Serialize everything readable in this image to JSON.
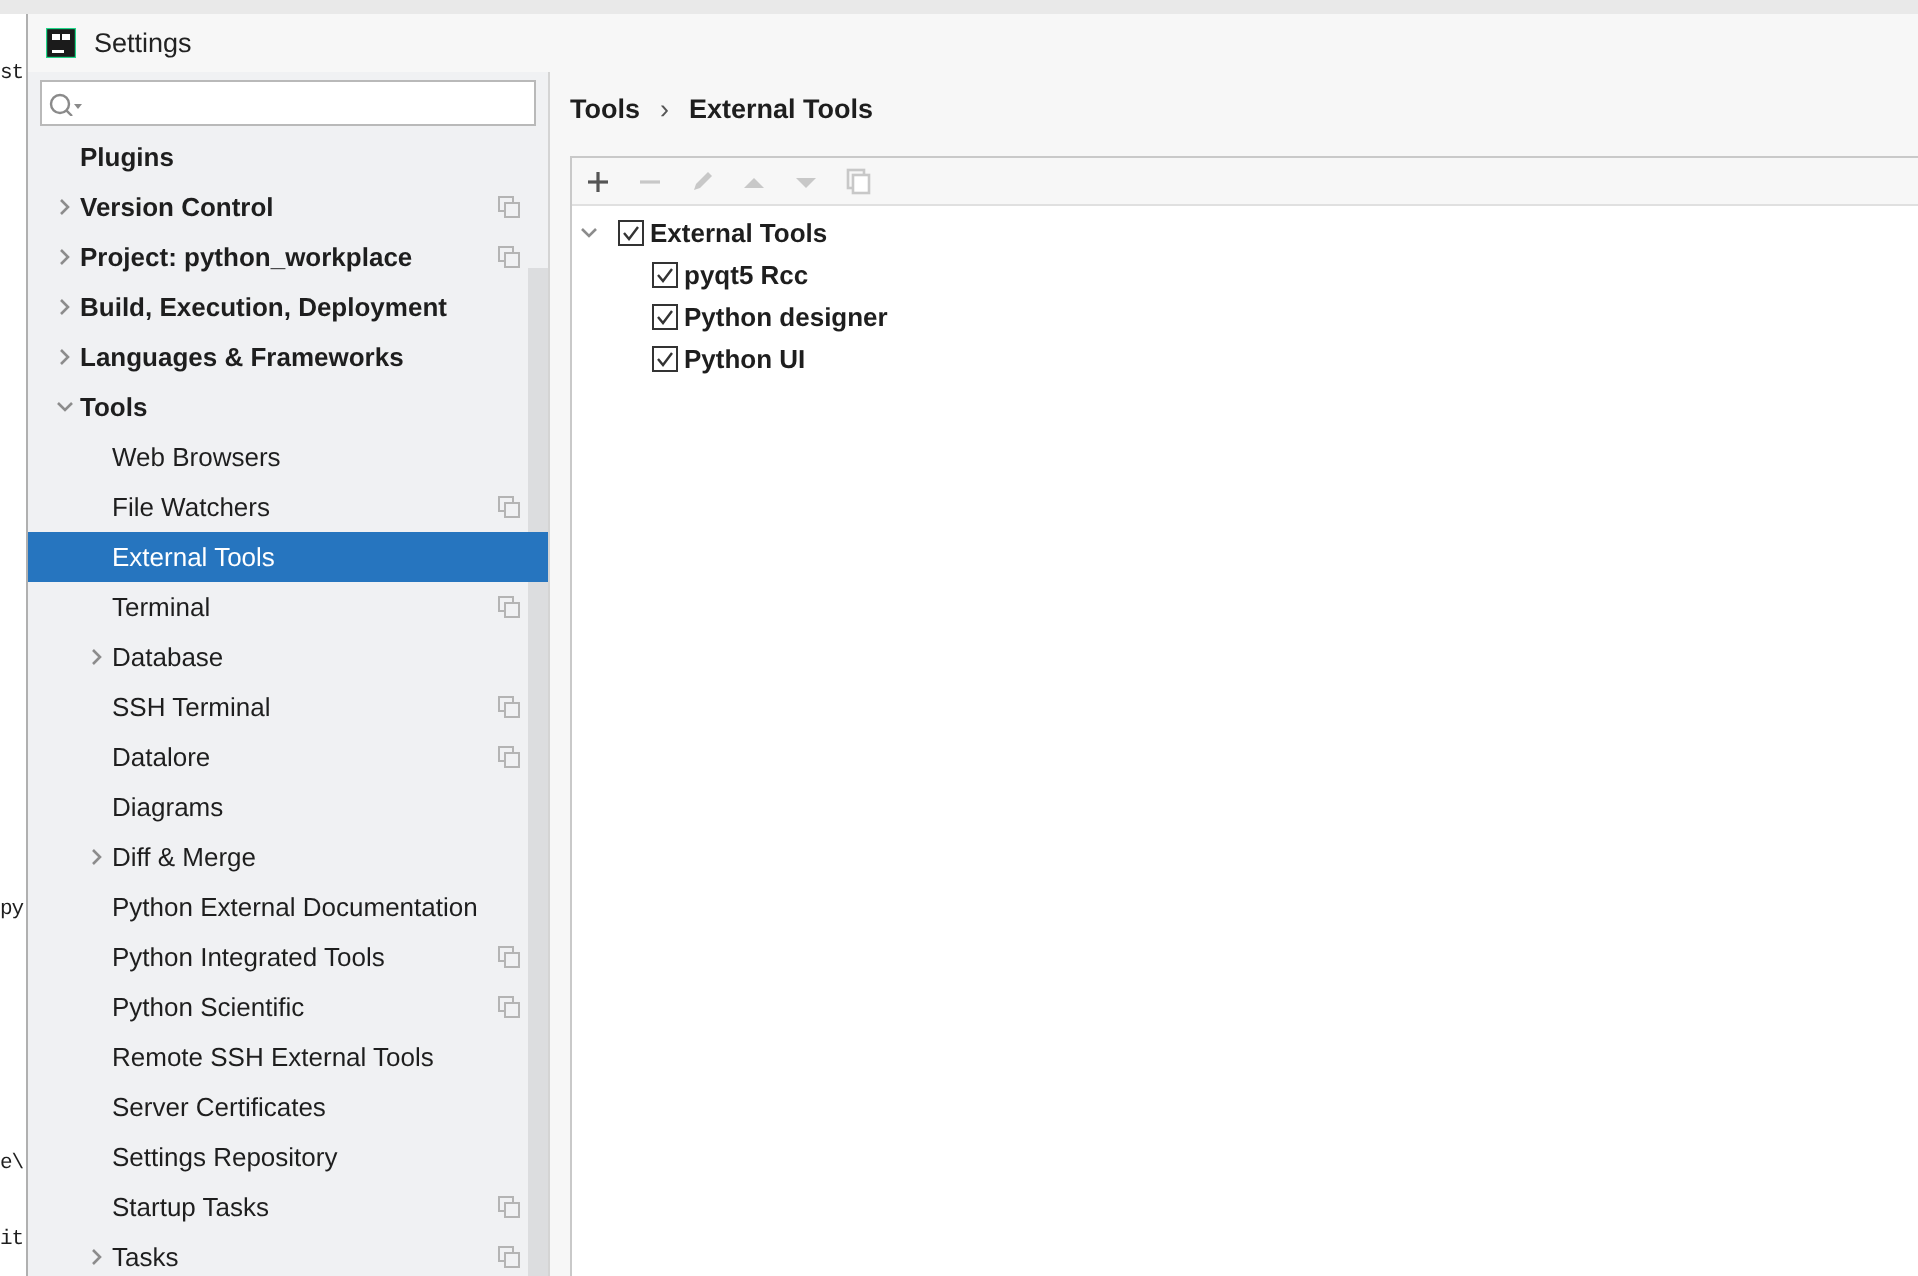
{
  "background_window": {
    "fragments": [
      "st",
      "py",
      "e\\",
      "it"
    ]
  },
  "window": {
    "title": "Settings"
  },
  "sidebar": {
    "items": [
      {
        "label": "Plugins",
        "selected": false,
        "project_level": false
      },
      {
        "label": "Version Control",
        "selected": false,
        "expanded": false,
        "project_level": true
      },
      {
        "label": "Project: python_workplace",
        "selected": false,
        "expanded": false,
        "project_level": true
      },
      {
        "label": "Build, Execution, Deployment",
        "selected": false,
        "expanded": false,
        "project_level": false
      },
      {
        "label": "Languages & Frameworks",
        "selected": false,
        "expanded": false,
        "project_level": false
      },
      {
        "label": "Tools",
        "selected": false,
        "expanded": true,
        "project_level": false,
        "children": [
          {
            "label": "Web Browsers",
            "selected": false,
            "project_level": false
          },
          {
            "label": "File Watchers",
            "selected": false,
            "project_level": true
          },
          {
            "label": "External Tools",
            "selected": true,
            "project_level": false
          },
          {
            "label": "Terminal",
            "selected": false,
            "project_level": true
          },
          {
            "label": "Database",
            "selected": false,
            "expanded": false,
            "project_level": false
          },
          {
            "label": "SSH Terminal",
            "selected": false,
            "project_level": true
          },
          {
            "label": "Datalore",
            "selected": false,
            "project_level": true
          },
          {
            "label": "Diagrams",
            "selected": false,
            "project_level": false
          },
          {
            "label": "Diff & Merge",
            "selected": false,
            "expanded": false,
            "project_level": false
          },
          {
            "label": "Python External Documentation",
            "selected": false,
            "project_level": false
          },
          {
            "label": "Python Integrated Tools",
            "selected": false,
            "project_level": true
          },
          {
            "label": "Python Scientific",
            "selected": false,
            "project_level": true
          },
          {
            "label": "Remote SSH External Tools",
            "selected": false,
            "project_level": false
          },
          {
            "label": "Server Certificates",
            "selected": false,
            "project_level": false
          },
          {
            "label": "Settings Repository",
            "selected": false,
            "project_level": false
          },
          {
            "label": "Startup Tasks",
            "selected": false,
            "project_level": true
          },
          {
            "label": "Tasks",
            "selected": false,
            "expanded": false,
            "project_level": true
          }
        ]
      }
    ]
  },
  "breadcrumb": [
    "Tools",
    "External Tools"
  ],
  "breadcrumb_separator": "›",
  "toolbar": [
    {
      "kind": "add",
      "disabled": false
    },
    {
      "kind": "remove",
      "disabled": true
    },
    {
      "kind": "edit",
      "disabled": true
    },
    {
      "kind": "up",
      "disabled": true
    },
    {
      "kind": "down",
      "disabled": true
    },
    {
      "kind": "copy",
      "disabled": true
    }
  ],
  "tree": [
    {
      "label": "External Tools",
      "checked": true,
      "expanded": true,
      "children": [
        {
          "label": "pyqt5 Rcc",
          "checked": true
        },
        {
          "label": "Python designer",
          "checked": true
        },
        {
          "label": "Python UI",
          "checked": true
        }
      ]
    }
  ]
}
